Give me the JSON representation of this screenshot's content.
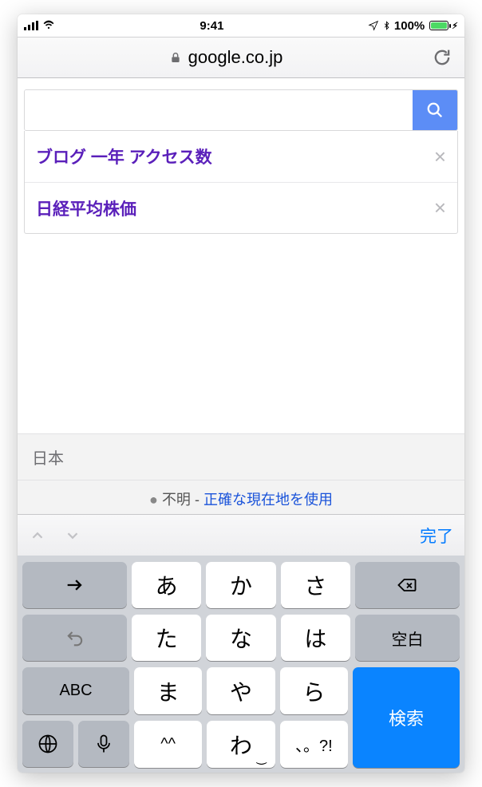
{
  "status": {
    "time": "9:41",
    "battery_pct": "100%"
  },
  "navbar": {
    "host": "google.co.jp"
  },
  "search": {
    "value": "",
    "placeholder": ""
  },
  "suggestions": [
    {
      "text": "ブログ 一年 アクセス数"
    },
    {
      "text": "日経平均株価"
    }
  ],
  "footer": {
    "country": "日本",
    "loc_unknown": "不明",
    "loc_sep": " - ",
    "loc_link": "正確な現在地を使用"
  },
  "kb_toolbar": {
    "done": "完了"
  },
  "keys": {
    "a": "あ",
    "ka": "か",
    "sa": "さ",
    "ta": "た",
    "na": "な",
    "ha": "は",
    "ma": "ま",
    "ya": "や",
    "ra": "ら",
    "face": "^^",
    "wa": "わ",
    "punct": "、。?!",
    "abc": "ABC",
    "space": "空白",
    "search": "検索"
  }
}
